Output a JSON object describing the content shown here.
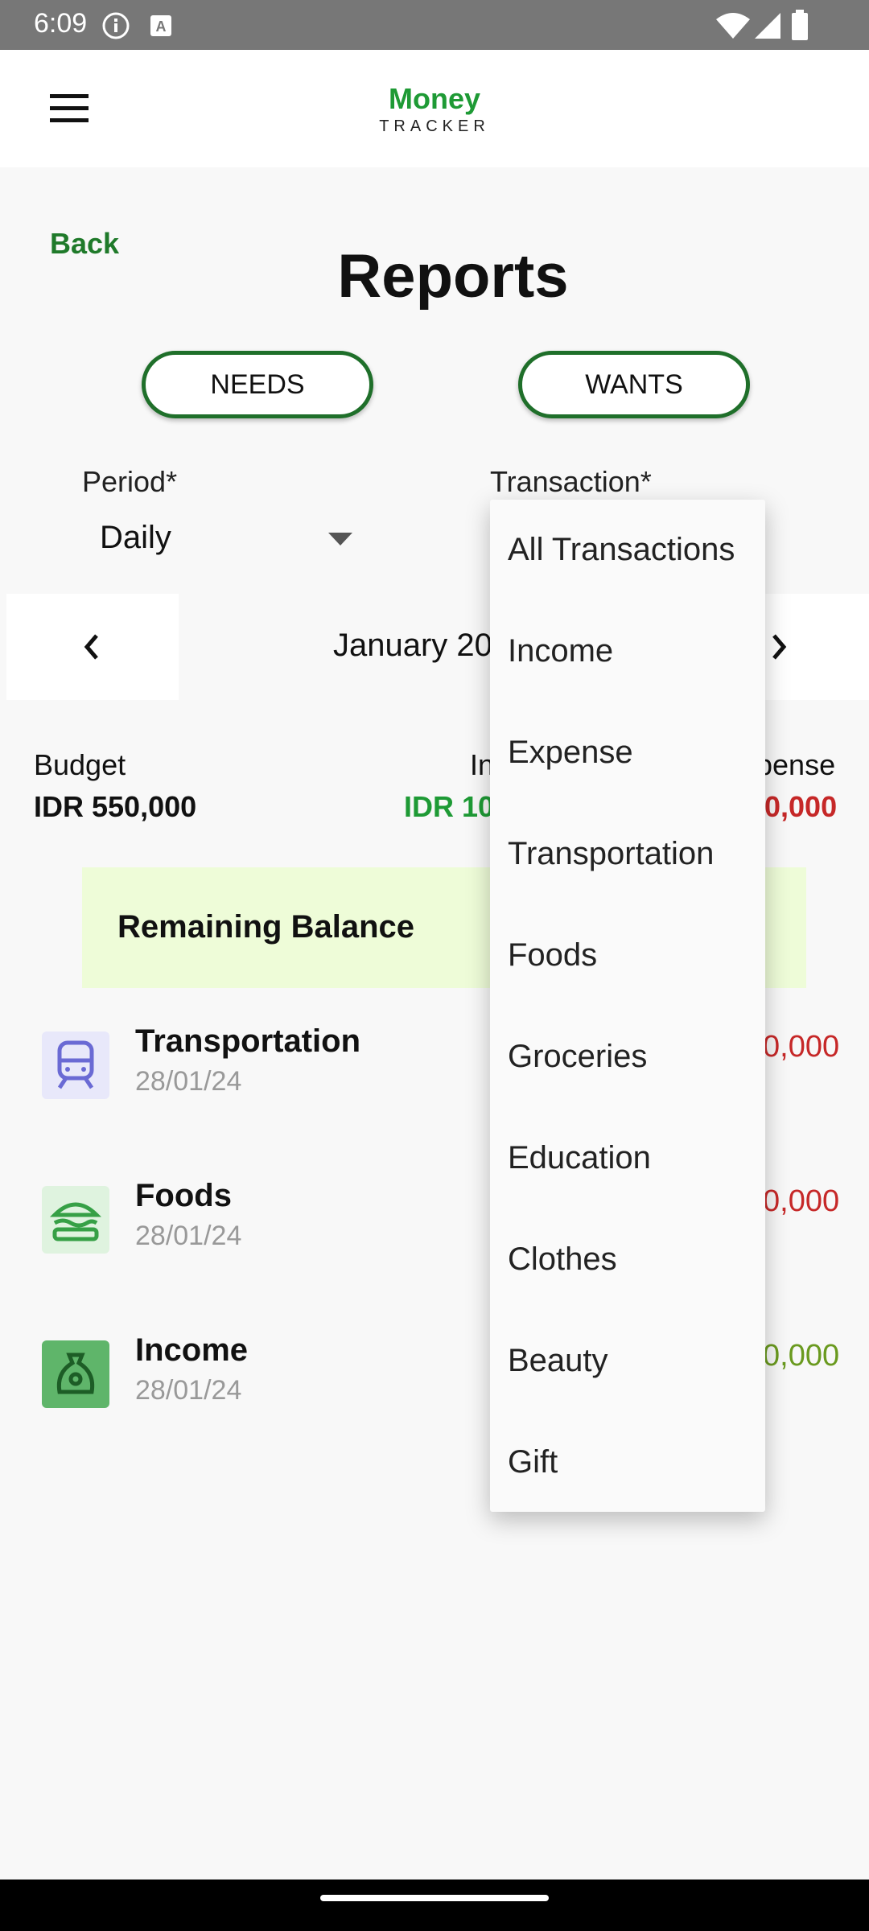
{
  "status_bar": {
    "time": "6:09"
  },
  "app": {
    "logo_top": "Money",
    "logo_bottom": "TRACKER"
  },
  "page": {
    "back_label": "Back",
    "title": "Reports"
  },
  "tabs": {
    "needs": "NEEDS",
    "wants": "WANTS"
  },
  "filters": {
    "period_label": "Period*",
    "period_value": "Daily",
    "transaction_label": "Transaction*"
  },
  "date_nav": {
    "label": "January 20"
  },
  "summary": {
    "budget_label": "Budget",
    "budget_value": "IDR 550,000",
    "income_label": "In",
    "income_value": "IDR 10",
    "expense_label": "pense",
    "expense_value": "0,000"
  },
  "remaining": {
    "label": "Remaining Balance"
  },
  "transactions": [
    {
      "name": "Transportation",
      "date": "28/01/24",
      "amount": "0,000",
      "amount_color": "#c62828",
      "icon": "train-icon"
    },
    {
      "name": "Foods",
      "date": "28/01/24",
      "amount": "0,000",
      "amount_color": "#c62828",
      "icon": "burger-icon"
    },
    {
      "name": "Income",
      "date": "28/01/24",
      "amount": "0,000",
      "amount_color": "#6a9a1f",
      "icon": "money-bag-icon"
    }
  ],
  "dropdown_options": [
    "All Transactions",
    "Income",
    "Expense",
    "Transportation",
    "Foods",
    "Groceries",
    "Education",
    "Clothes",
    "Beauty",
    "Gift"
  ],
  "colors": {
    "brand_green": "#1e9a35",
    "expense_red": "#c62828",
    "income_green": "#1e9a35",
    "remaining_bg": "#eefcd8"
  }
}
